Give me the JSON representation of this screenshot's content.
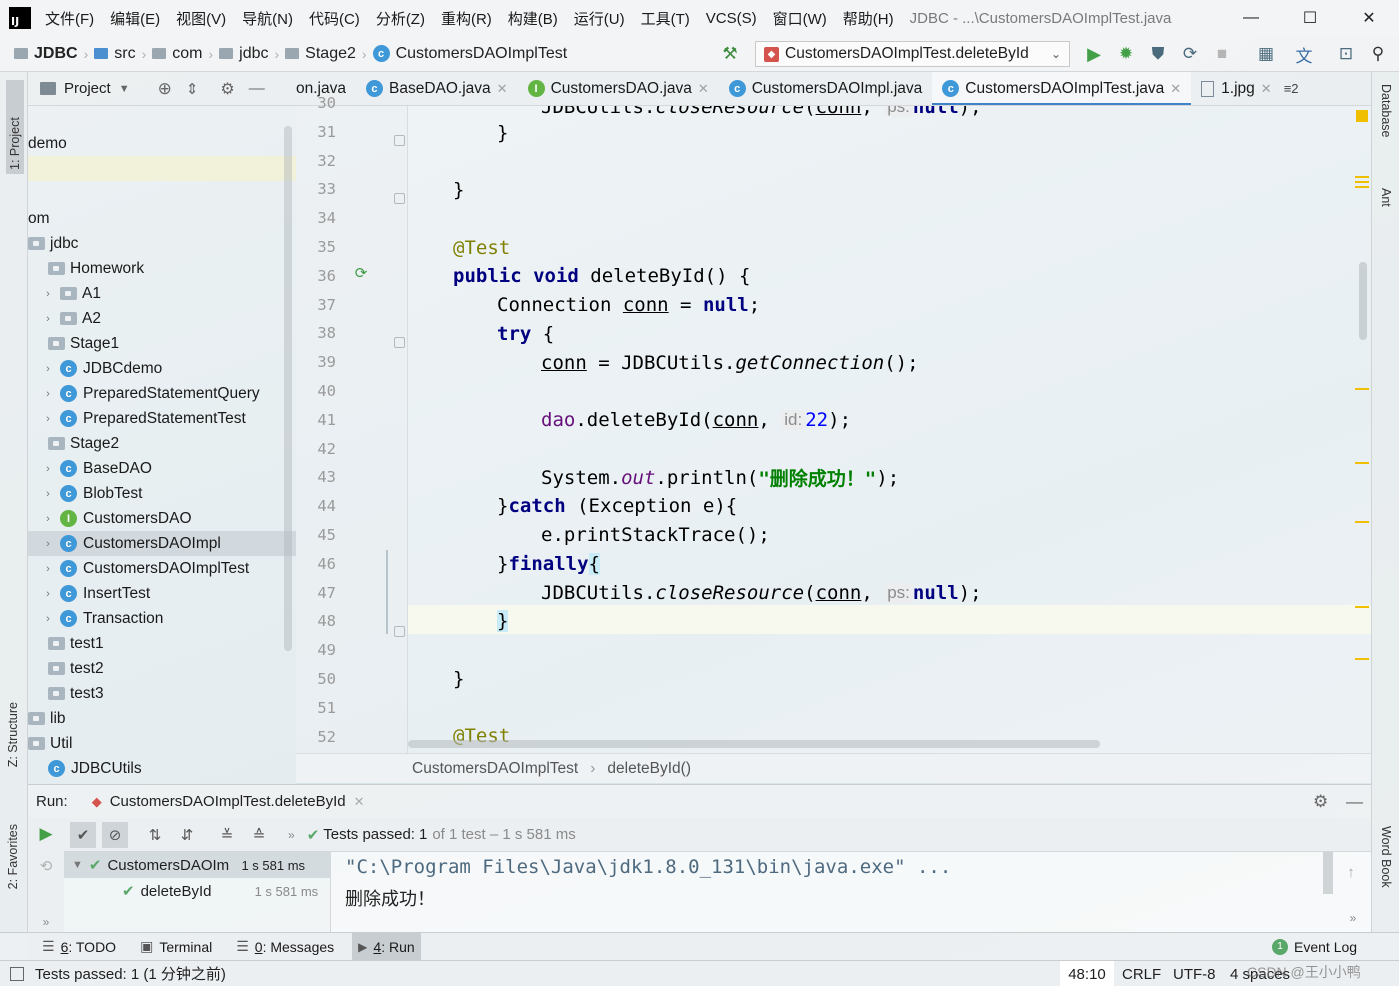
{
  "menubar": {
    "items": [
      "文件(F)",
      "编辑(E)",
      "视图(V)",
      "导航(N)",
      "代码(C)",
      "分析(Z)",
      "重构(R)",
      "构建(B)",
      "运行(U)",
      "工具(T)",
      "VCS(S)",
      "窗口(W)",
      "帮助(H)"
    ],
    "window_title": "JDBC - ...\\CustomersDAOImplTest.java",
    "minimize": "—",
    "maximize": "☐",
    "close": "✕"
  },
  "navbar": {
    "crumbs": [
      "JDBC",
      "src",
      "com",
      "jdbc",
      "Stage2",
      "CustomersDAOImplTest"
    ],
    "run_config": "CustomersDAOImplTest.deleteById"
  },
  "left_strip": {
    "project_tab": "1: Project",
    "structure_tab": "Z: Structure",
    "favorites_tab": "2: Favorites"
  },
  "right_strip": {
    "database_tab": "Database",
    "ant_tab": "Ant",
    "wordbook_tab": "Word Book"
  },
  "project_panel": {
    "title": "Project",
    "tree": [
      {
        "label": "demo",
        "level": 0,
        "kind": "text"
      },
      {
        "label": "om",
        "level": 0,
        "kind": "text"
      },
      {
        "label": "jdbc",
        "level": 0,
        "kind": "pkg"
      },
      {
        "label": "Homework",
        "level": 1,
        "kind": "pkg"
      },
      {
        "label": "A1",
        "level": 2,
        "kind": "pkg"
      },
      {
        "label": "A2",
        "level": 2,
        "kind": "pkg"
      },
      {
        "label": "Stage1",
        "level": 1,
        "kind": "pkg"
      },
      {
        "label": "JDBCdemo",
        "level": 2,
        "kind": "class"
      },
      {
        "label": "PreparedStatementQuery",
        "level": 2,
        "kind": "class"
      },
      {
        "label": "PreparedStatementTest",
        "level": 2,
        "kind": "class"
      },
      {
        "label": "Stage2",
        "level": 1,
        "kind": "pkg"
      },
      {
        "label": "BaseDAO",
        "level": 2,
        "kind": "class"
      },
      {
        "label": "BlobTest",
        "level": 2,
        "kind": "class"
      },
      {
        "label": "CustomersDAO",
        "level": 2,
        "kind": "interface"
      },
      {
        "label": "CustomersDAOImpl",
        "level": 2,
        "kind": "class"
      },
      {
        "label": "CustomersDAOImplTest",
        "level": 2,
        "kind": "class"
      },
      {
        "label": "InsertTest",
        "level": 2,
        "kind": "class"
      },
      {
        "label": "Transaction",
        "level": 2,
        "kind": "class"
      },
      {
        "label": "test1",
        "level": 1,
        "kind": "pkg"
      },
      {
        "label": "test2",
        "level": 1,
        "kind": "pkg"
      },
      {
        "label": "test3",
        "level": 1,
        "kind": "pkg"
      },
      {
        "label": "lib",
        "level": 0,
        "kind": "pkg"
      },
      {
        "label": "Util",
        "level": 0,
        "kind": "pkg"
      },
      {
        "label": "JDBCUtils",
        "level": 1,
        "kind": "class"
      }
    ]
  },
  "editor": {
    "tabs": [
      {
        "label": "on.java",
        "icon": "none"
      },
      {
        "label": "BaseDAO.java",
        "icon": "class"
      },
      {
        "label": "CustomersDAO.java",
        "icon": "interface"
      },
      {
        "label": "CustomersDAOImpl.java",
        "icon": "class"
      },
      {
        "label": "CustomersDAOImplTest.java",
        "icon": "class"
      },
      {
        "label": "1.jpg",
        "icon": "image"
      }
    ],
    "tab_overflow": "≡2",
    "lines": [
      30,
      31,
      32,
      33,
      34,
      35,
      36,
      37,
      38,
      39,
      40,
      41,
      42,
      43,
      44,
      45,
      46,
      47,
      48,
      49,
      50,
      51,
      52
    ],
    "breadcrumb": [
      "CustomersDAOImplTest",
      "deleteById()"
    ]
  },
  "run_panel": {
    "label": "Run:",
    "tab": "CustomersDAOImplTest.deleteById",
    "status_prefix": "Tests passed:",
    "status_count": "1",
    "status_suffix": "of 1 test – 1 s 581 ms",
    "tests": [
      {
        "name": "CustomersDAOIm",
        "time": "1 s 581 ms"
      },
      {
        "name": "deleteById",
        "time": "1 s 581 ms"
      }
    ],
    "console_lines": [
      "\"C:\\Program Files\\Java\\jdk1.8.0_131\\bin\\java.exe\" ...",
      "删除成功！"
    ]
  },
  "tool_tabs": [
    {
      "num": "6",
      "label": ": TODO"
    },
    {
      "num": "",
      "label": "Terminal"
    },
    {
      "num": "0",
      "label": ": Messages"
    },
    {
      "num": "4",
      "label": ": Run"
    }
  ],
  "event_log": {
    "badge": "1",
    "label": "Event Log"
  },
  "statusbar": {
    "message": "Tests passed: 1 (1 分钟之前)",
    "position": "48:10",
    "line_sep": "CRLF",
    "encoding": "UTF-8",
    "indent": "4 spaces",
    "watermark": "CSDN @王小小鸭"
  },
  "colors": {
    "accent": "#4083c9",
    "keyword": "#000080",
    "annotation": "#808000",
    "string": "#008000",
    "pass": "#59a869"
  }
}
